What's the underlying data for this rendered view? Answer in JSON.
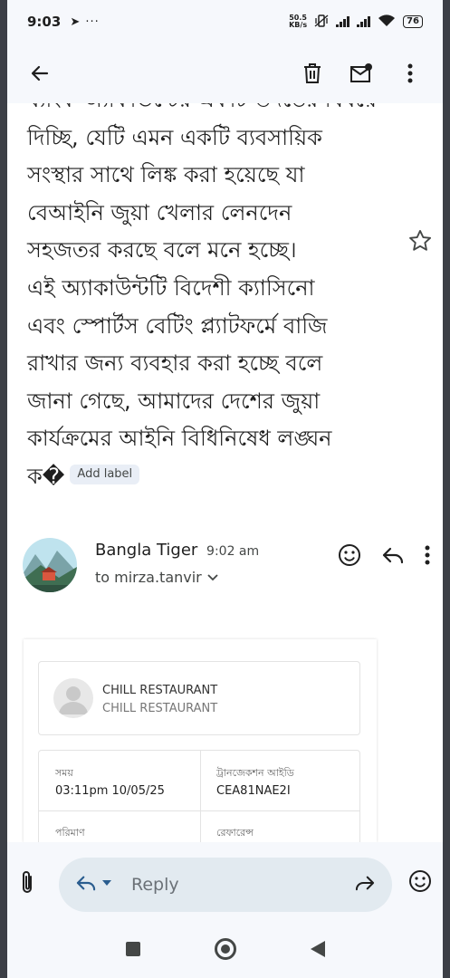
{
  "status_bar": {
    "time": "9:03",
    "misc_icons": "➤ ···",
    "speed_value": "50.5",
    "speed_unit": "KB/s",
    "battery": "76"
  },
  "app_bar": {
    "back_icon": "arrow-left",
    "delete_icon": "trash",
    "unread_icon": "mail-badge",
    "more_icon": "more-vert"
  },
  "email": {
    "body_lines": [
      "ব্যাংক অ্যাকাউন্টের একটি তদন্তের বিষয়ে",
      "দিচ্ছি, যেটি এমন একটি ব্যবসায়িক",
      "সংস্থার সাথে লিঙ্ক করা হয়েছে যা",
      "বেআইনি জুয়া খেলার লেনদেন",
      "সহজতর করছে বলে মনে হচ্ছে।",
      "এই অ্যাকাউন্টটি বিদেশী ক্যাসিনো",
      "এবং স্পোর্টস বেটিং প্ল্যাটফর্মে বাজি",
      "রাখার জন্য ব্যবহার করা হচ্ছে বলে",
      "জানা গেছে, আমাদের দেশের জুয়া",
      "কার্যক্রমের আইনি বিধিনিষেধ লঙ্ঘন",
      "ক�"
    ],
    "add_label": "Add label",
    "sender": {
      "name": "Bangla Tiger",
      "time": "9:02 am",
      "to": "to mirza.tanvir"
    }
  },
  "receipt": {
    "merchant_name": "CHILL RESTAURANT",
    "merchant_sub": "CHILL RESTAURANT",
    "time_label": "সময়",
    "time_value": "03:11pm 10/05/25",
    "txn_label": "ট্রানজেকশন আইডি",
    "txn_value": "CEA81NAE2I",
    "amount_label": "পরিমাণ",
    "ref_label": "রেফারেন্স"
  },
  "reply_bar": {
    "placeholder": "Reply"
  },
  "colors": {
    "background": "#f6f8fc",
    "surface": "#ffffff",
    "pill": "#e2eaf0",
    "text": "#1f1f1f"
  }
}
